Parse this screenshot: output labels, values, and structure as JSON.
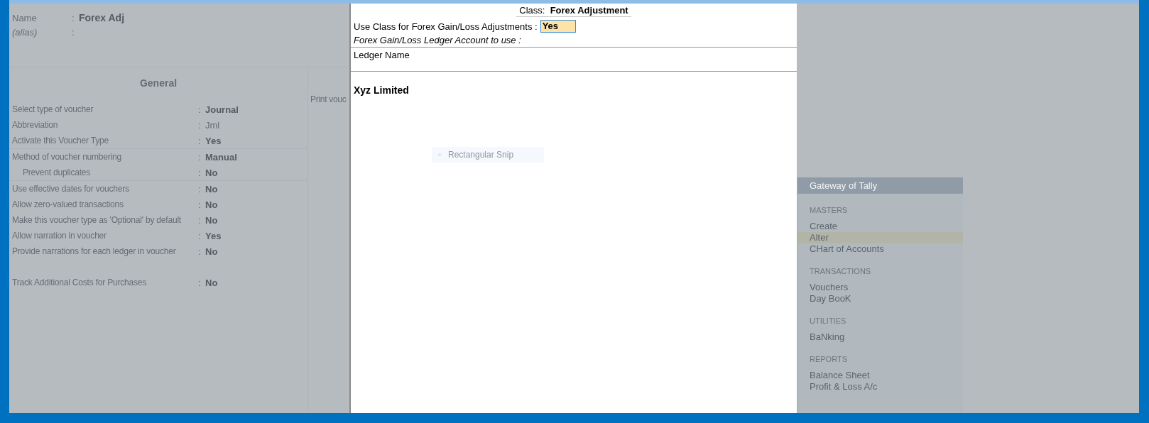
{
  "voucher_type": {
    "name_label": "Name",
    "name_colon": ":",
    "name": "Forex Adj",
    "alias_label": "(alias)",
    "alias_colon": ":"
  },
  "colon": ":",
  "general": {
    "title": "General",
    "groups": [
      {
        "ruled": true,
        "rows": [
          {
            "label": "Select type of voucher",
            "value": "Journal",
            "bold": true,
            "indent": false
          },
          {
            "label": "Abbreviation",
            "value": "Jml",
            "bold": false,
            "indent": false
          },
          {
            "label": "Activate this Voucher Type",
            "value": "Yes",
            "bold": true,
            "indent": false
          }
        ]
      },
      {
        "ruled": true,
        "rows": [
          {
            "label": "Method of voucher numbering",
            "value": "Manual",
            "bold": true,
            "indent": false
          },
          {
            "label": "Prevent duplicates",
            "value": "No",
            "bold": true,
            "indent": true
          }
        ]
      },
      {
        "ruled": false,
        "rows": [
          {
            "label": "Use effective dates for vouchers",
            "value": "No",
            "bold": true,
            "indent": false
          },
          {
            "label": "Allow zero-valued transactions",
            "value": "No",
            "bold": true,
            "indent": false
          },
          {
            "label": "Make this voucher type as 'Optional' by default",
            "value": "No",
            "bold": true,
            "indent": false
          },
          {
            "label": "Allow narration in voucher",
            "value": "Yes",
            "bold": true,
            "indent": false
          },
          {
            "label": "Provide narrations for each ledger in voucher",
            "value": "No",
            "bold": true,
            "indent": false
          }
        ]
      },
      {
        "ruled": false,
        "rows": [
          {
            "label": "Track Additional Costs for Purchases",
            "value": "No",
            "bold": true,
            "indent": false
          }
        ]
      }
    ]
  },
  "print_column": {
    "label": "Print vouc"
  },
  "class_dialog": {
    "class_label": "Class:",
    "class_name": "Forex Adjustment",
    "use_class_label": "Use Class for Forex Gain/Loss Adjustments :",
    "use_class_value": "Yes",
    "ledger_prompt": "Forex Gain/Loss Ledger Account to use :",
    "column_header": "Ledger Name",
    "ledgers": [
      "Xyz Limited"
    ]
  },
  "snip_tooltip": {
    "label": "Rectangular Snip"
  },
  "gateway": {
    "title": "Gateway of Tally",
    "sections": [
      {
        "heading": "MASTERS",
        "items": [
          {
            "label": "Create",
            "selected": false
          },
          {
            "label": "Alter",
            "selected": true
          },
          {
            "label": "CHart of Accounts",
            "selected": false
          }
        ]
      },
      {
        "heading": "TRANSACTIONS",
        "items": [
          {
            "label": "Vouchers",
            "selected": false
          },
          {
            "label": "Day BooK",
            "selected": false
          }
        ]
      },
      {
        "heading": "UTILITIES",
        "items": [
          {
            "label": "BaNking",
            "selected": false
          }
        ]
      },
      {
        "heading": "REPORTS",
        "items": [
          {
            "label": "Balance Sheet",
            "selected": false
          },
          {
            "label": "Profit & Loss A/c",
            "selected": false
          }
        ]
      }
    ]
  }
}
